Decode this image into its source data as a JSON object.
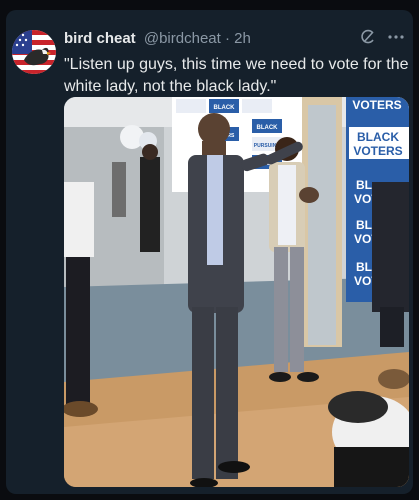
{
  "post": {
    "display_name": "bird cheat",
    "handle": "@birdcheat",
    "separator": "·",
    "time": "2h",
    "text": "\"Listen up guys, this time we need to vote for the white lady, not the black lady.\""
  },
  "media": {
    "signs": {
      "voters_1": "VOTERS",
      "black_1": "BLACK",
      "voters_2": "VOTERS",
      "partial_1": "BL",
      "partial_2": "VOT",
      "partial_3": "BL",
      "partial_4": "VOT",
      "partial_5": "BLA",
      "partial_6": "VOTE",
      "small_black_1": "BLACK",
      "small_voters_1": "VOTERS",
      "small_black_2": "BLACK",
      "small_voters_2": "VOTERS",
      "small_pursuing": "PURSUING"
    }
  },
  "icons": {
    "grok": "grok-icon",
    "more": "more-icon",
    "avatar": "avatar-flag-eagle"
  },
  "colors": {
    "card_bg": "#15202b",
    "page_bg": "#0a0c10",
    "muted_text": "#8b98a5",
    "sign_blue": "#2a5ea8"
  }
}
